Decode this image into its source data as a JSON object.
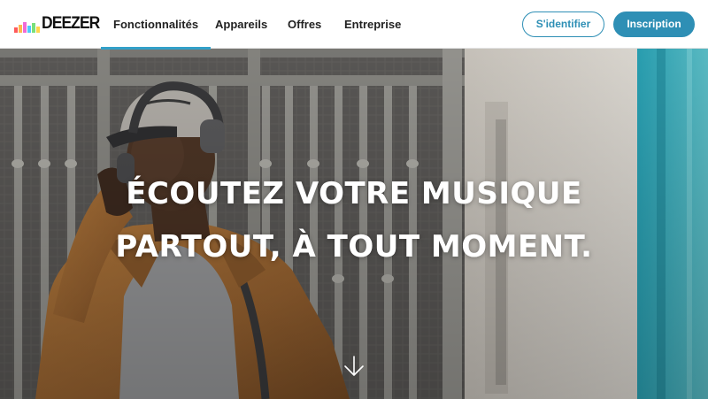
{
  "brand": {
    "name": "DEEZER",
    "bar_colors": [
      "#ff4d4d",
      "#ffb84d",
      "#f06ad6",
      "#4dc9ff",
      "#7ae07a",
      "#ffd54d"
    ]
  },
  "nav": {
    "items": [
      {
        "label": "Fonctionnalités",
        "active": true
      },
      {
        "label": "Appareils",
        "active": false
      },
      {
        "label": "Offres",
        "active": false
      },
      {
        "label": "Entreprise",
        "active": false
      }
    ],
    "login_label": "S'identifier",
    "signup_label": "Inscription"
  },
  "hero": {
    "headline_line1": "ÉCOUTEZ VOTRE MUSIQUE",
    "headline_line2": "PARTOUT, À TOUT MOMENT.",
    "scroll_icon": "arrow-down-icon"
  },
  "colors": {
    "accent": "#2e8fb5",
    "active_underline": "#32a0c8"
  }
}
